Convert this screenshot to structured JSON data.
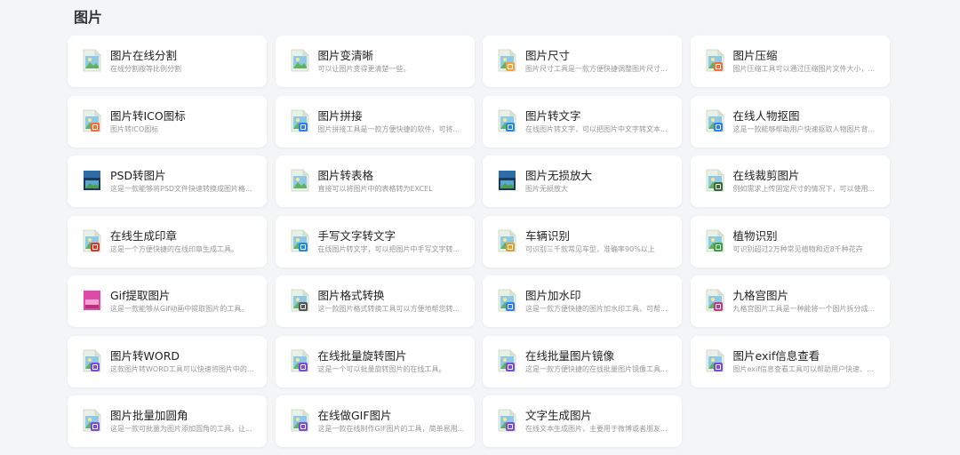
{
  "section": {
    "title": "图片"
  },
  "tools": [
    {
      "title": "图片在线分割",
      "desc": "在线分割按等比例分割",
      "icon": "image-file-icon",
      "badge": "none",
      "badge_color": ""
    },
    {
      "title": "图片变清晰",
      "desc": "可以让图片变得更清楚一些。",
      "icon": "image-file-icon",
      "badge": "none",
      "badge_color": ""
    },
    {
      "title": "图片尺寸",
      "desc": "图片尺寸工具是一款方便快捷调整图片尺寸...",
      "icon": "image-file-icon",
      "badge": "ruler",
      "badge_color": "#f0a33a"
    },
    {
      "title": "图片压缩",
      "desc": "图片压缩工具可以通过压缩图片文件大小，...",
      "icon": "image-file-icon",
      "badge": "compress",
      "badge_color": "#f06f3a"
    },
    {
      "title": "图片转ICO图标",
      "desc": "图片转ICO图标",
      "icon": "image-file-icon",
      "badge": "ico",
      "badge_color": "#f06f3a"
    },
    {
      "title": "图片拼接",
      "desc": "图片拼接工具是一款方便快捷的软件，可将...",
      "icon": "image-file-icon",
      "badge": "grid",
      "badge_color": "#2d7ff0"
    },
    {
      "title": "图片转文字",
      "desc": "在线图片转文字，可以把图片中文字转文本...",
      "icon": "image-file-icon",
      "badge": "text",
      "badge_color": "#1f8ad8"
    },
    {
      "title": "在线人物抠图",
      "desc": "这是一款能够帮助用户快速抠取人物图片背...",
      "icon": "image-file-icon",
      "badge": "grid",
      "badge_color": "#2d7ff0"
    },
    {
      "title": "PSD转图片",
      "desc": "这是一款能够将PSD文件快速转换成图片格...",
      "icon": "psd-file-icon",
      "badge": "none",
      "badge_color": ""
    },
    {
      "title": "图片转表格",
      "desc": "直接可以将图片中的表格转为EXCEL",
      "icon": "image-file-icon",
      "badge": "none",
      "badge_color": ""
    },
    {
      "title": "图片无损放大",
      "desc": "图片无损放大",
      "icon": "psd-file-icon",
      "badge": "none",
      "badge_color": ""
    },
    {
      "title": "在线裁剪图片",
      "desc": "例如需求上传固定尺寸的情况下，可以使用...",
      "icon": "image-file-icon",
      "badge": "crop",
      "badge_color": "#3a6a3a"
    },
    {
      "title": "在线生成印章",
      "desc": "这是一个方便快捷的在线印章生成工具。",
      "icon": "image-file-icon",
      "badge": "seal",
      "badge_color": "#d83a2a"
    },
    {
      "title": "手写文字转文字",
      "desc": "在线图片转文字，可以把图片中手写文字转...",
      "icon": "image-file-icon",
      "badge": "text",
      "badge_color": "#1f8ad8"
    },
    {
      "title": "车辆识别",
      "desc": "可识别三千款常见车型，准确率90%以上",
      "icon": "image-file-icon",
      "badge": "car",
      "badge_color": "#e0a030"
    },
    {
      "title": "植物识别",
      "desc": "可识别超过2万种常见植物和近8千种花卉",
      "icon": "image-file-icon",
      "badge": "plant",
      "badge_color": "#3aa040"
    },
    {
      "title": "Gif提取图片",
      "desc": "这是一款能够从Gif动画中提取图片的工具。",
      "icon": "gif-file-icon",
      "badge": "none",
      "badge_color": ""
    },
    {
      "title": "图片格式转换",
      "desc": "这一款图片格式转换工具可以方便地帮您转...",
      "icon": "image-file-icon",
      "badge": "convert",
      "badge_color": "#555555"
    },
    {
      "title": "图片加水印",
      "desc": "这是一款方便快捷的图片加水印工具，可帮...",
      "icon": "image-file-icon",
      "badge": "watermark",
      "badge_color": "#2d7ff0"
    },
    {
      "title": "九格宫图片",
      "desc": "九格宫图片工具是一种能将一个图片拆分成...",
      "icon": "image-file-icon",
      "badge": "grid9",
      "badge_color": "#c23a8a"
    },
    {
      "title": "图片转WORD",
      "desc": "这款图片转WORD工具可以快速将图片中的...",
      "icon": "image-file-icon",
      "badge": "monitor",
      "badge_color": "#7a4ad8"
    },
    {
      "title": "在线批量旋转图片",
      "desc": "这是一个可以批量旋转图片的在线工具。",
      "icon": "image-file-icon",
      "badge": "monitor",
      "badge_color": "#7a4ad8"
    },
    {
      "title": "在线批量图片镜像",
      "desc": "这是一款方便快捷的在线批量图片镜像工具...",
      "icon": "image-file-icon",
      "badge": "monitor",
      "badge_color": "#7a4ad8"
    },
    {
      "title": "图片exif信息查看",
      "desc": "图片exif信息查看工具可以帮助用户快速、方...",
      "icon": "image-file-icon",
      "badge": "monitor",
      "badge_color": "#7a4ad8"
    },
    {
      "title": "图片批量加圆角",
      "desc": "这是一款可批量为图片添加圆角的工具，让...",
      "icon": "image-file-icon",
      "badge": "monitor",
      "badge_color": "#7a4ad8"
    },
    {
      "title": "在线做GIF图片",
      "desc": "这是一款在线制作GIF图片的工具，简单易用...",
      "icon": "image-file-icon",
      "badge": "monitor",
      "badge_color": "#7a4ad8"
    },
    {
      "title": "文字生成图片",
      "desc": "在线文本生成图片，主要用于微博或者朋友...",
      "icon": "image-file-icon",
      "badge": "monitor",
      "badge_color": "#7a4ad8"
    }
  ]
}
